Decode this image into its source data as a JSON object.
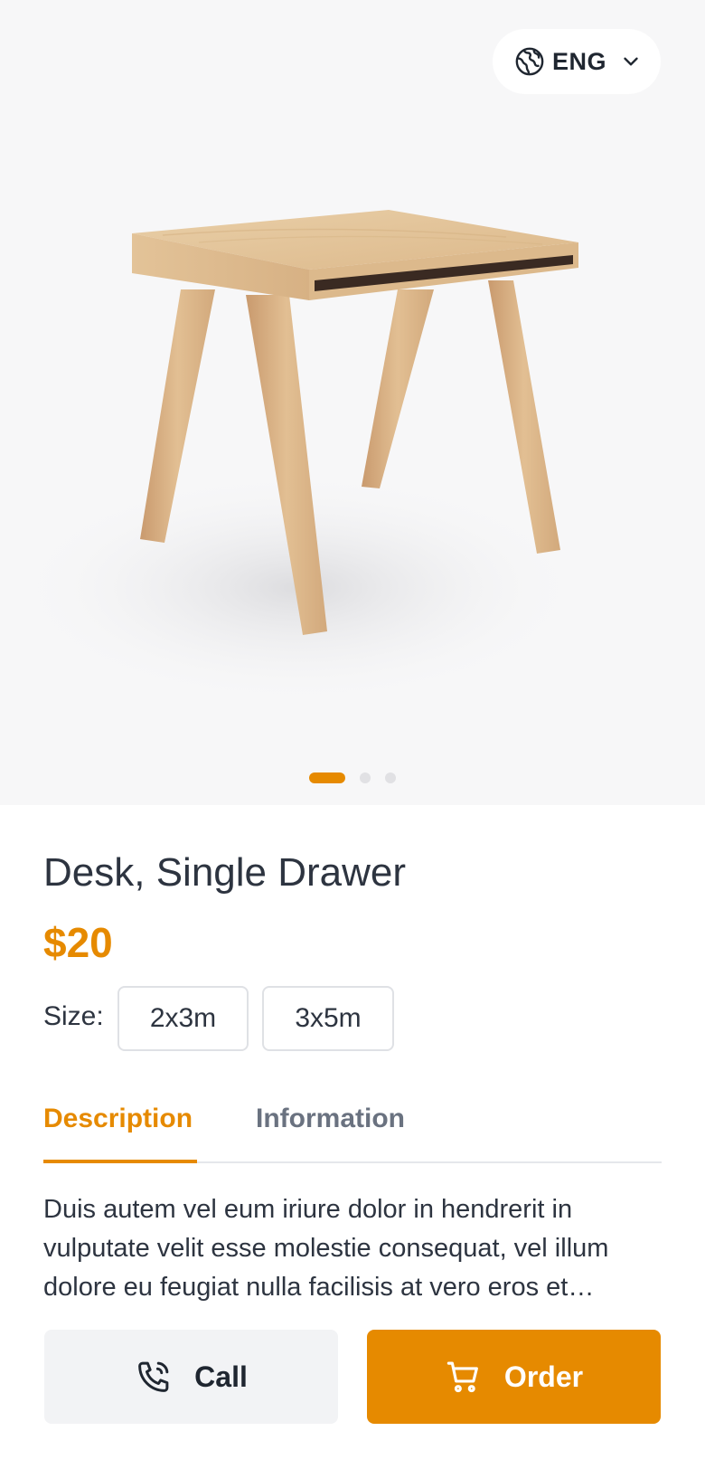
{
  "language": {
    "label": "ENG",
    "icon": "globe-icon",
    "dropdown_icon": "chevron-down-icon"
  },
  "carousel": {
    "total_slides": 3,
    "active_index": 0
  },
  "product": {
    "title": "Desk, Single Drawer",
    "price": "$20",
    "size_label": "Size:",
    "sizes": [
      "2x3m",
      "3x5m"
    ]
  },
  "tabs": [
    {
      "label": "Description",
      "active": true
    },
    {
      "label": "Information",
      "active": false
    }
  ],
  "description": "Duis autem vel eum iriure dolor in hendrerit in vulputate velit esse molestie consequat, vel illum dolore eu feugiat nulla facilisis at vero eros et…",
  "actions": {
    "call": {
      "label": "Call",
      "icon": "phone-icon"
    },
    "order": {
      "label": "Order",
      "icon": "cart-icon"
    }
  },
  "colors": {
    "accent": "#e68a00",
    "text": "#2d3440",
    "muted": "#6a7280",
    "hero_bg": "#f7f7f8"
  }
}
